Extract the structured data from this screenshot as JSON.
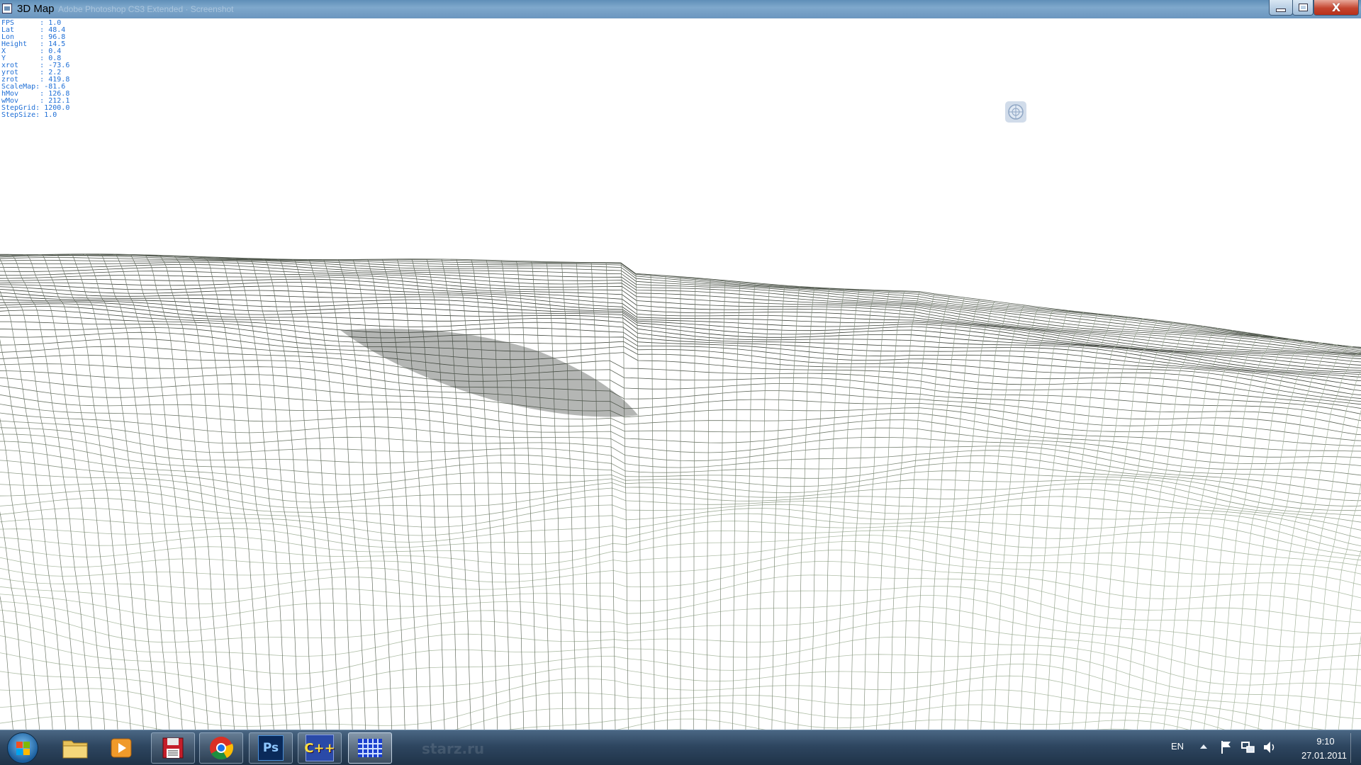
{
  "window": {
    "title": "3D Map",
    "background_title": "Adobe Photoshop CS3 Extended · Screenshot"
  },
  "hud": [
    {
      "key": "FPS      :",
      "value": "1.0"
    },
    {
      "key": "Lat      :",
      "value": "48.4"
    },
    {
      "key": "Lon      :",
      "value": "96.8"
    },
    {
      "key": "Height   :",
      "value": "14.5"
    },
    {
      "key": "X        :",
      "value": "0.4"
    },
    {
      "key": "Y        :",
      "value": "0.8"
    },
    {
      "key": "xrot     :",
      "value": "-73.6"
    },
    {
      "key": "yrot     :",
      "value": "2.2"
    },
    {
      "key": "zrot     :",
      "value": "419.8"
    },
    {
      "key": "ScaleMap:",
      "value": "-81.6"
    },
    {
      "key": "hMov     :",
      "value": "126.8"
    },
    {
      "key": "wMov     :",
      "value": "212.1"
    },
    {
      "key": "StepGrid:",
      "value": "1200.0"
    },
    {
      "key": "StepSize:",
      "value": "1.0"
    }
  ],
  "taskbar": {
    "items": [
      {
        "name": "explorer",
        "icon": "folder-icon",
        "state": "pinned"
      },
      {
        "name": "media-player",
        "icon": "media-player-icon",
        "state": "pinned"
      },
      {
        "name": "save-app",
        "icon": "floppy-disk-icon",
        "state": "running"
      },
      {
        "name": "chrome",
        "icon": "chrome-icon",
        "state": "running"
      },
      {
        "name": "photoshop",
        "icon": "photoshop-icon",
        "state": "running",
        "label": "Ps"
      },
      {
        "name": "cpp-builder",
        "icon": "cpp-builder-icon",
        "state": "running",
        "label": "C++"
      },
      {
        "name": "3d-map-app",
        "icon": "grid-app-icon",
        "state": "active"
      }
    ],
    "watermark": "starz.ru",
    "language": "EN",
    "time": "9:10",
    "date": "27.01.2011"
  },
  "colors": {
    "hud_text": "#1f6fd6",
    "mesh_dark": "#2f3a2c",
    "mesh_light": "#9a9a8c"
  }
}
